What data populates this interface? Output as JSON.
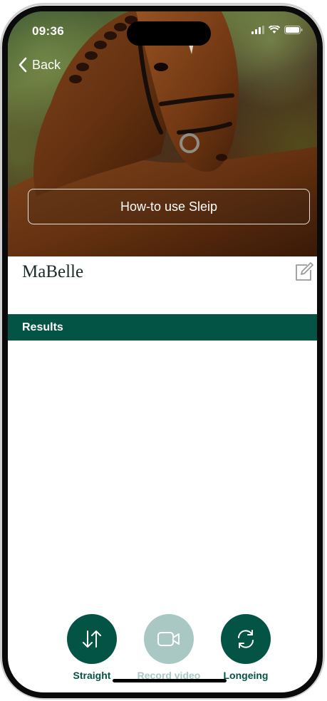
{
  "status_bar": {
    "time": "09:36",
    "icons": [
      "signal-icon",
      "wifi-icon",
      "battery-icon"
    ]
  },
  "nav": {
    "back_label": "Back",
    "back_icon": "chevron-left-icon"
  },
  "hero": {
    "howto_label": "How-to use Sleip"
  },
  "horse": {
    "name": "MaBelle",
    "edit_icon": "edit-icon"
  },
  "results": {
    "title": "Results"
  },
  "actions": [
    {
      "label": "Straight",
      "icon": "swap-vertical-icon",
      "enabled": true
    },
    {
      "label": "Record video",
      "icon": "video-camera-icon",
      "enabled": false
    },
    {
      "label": "Longeing",
      "icon": "refresh-icon",
      "enabled": true
    }
  ],
  "colors": {
    "brand": "#045446",
    "brand_disabled": "#a9c8c4",
    "text_dark": "#1c2b2a"
  }
}
